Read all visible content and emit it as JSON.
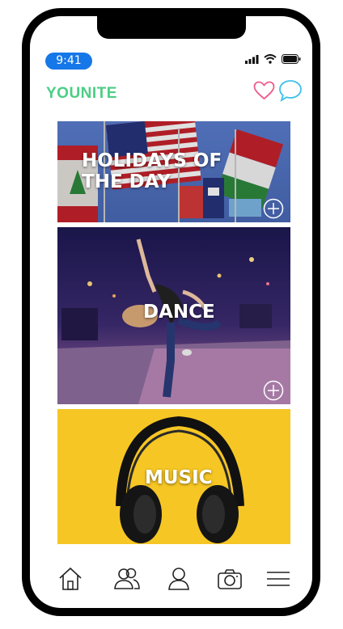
{
  "status_bar": {
    "time": "9:41"
  },
  "header": {
    "brand": "YOUNITE"
  },
  "cards": [
    {
      "label": "HOLIDAYS OF THE DAY"
    },
    {
      "label": "DANCE"
    },
    {
      "label": "MUSIC"
    }
  ],
  "icons": {
    "favorites": "heart-icon",
    "messages": "chat-bubble-icon",
    "add": "plus-circle-icon",
    "home": "home-icon",
    "friends": "group-icon",
    "profile": "user-icon",
    "camera": "camera-icon",
    "menu": "hamburger-icon"
  },
  "colors": {
    "brand": "#4ccd84",
    "heart": "#ef5b8a",
    "chat": "#3fc0e8",
    "time_pill": "#1677e8",
    "music_bg": "#f6c624"
  }
}
